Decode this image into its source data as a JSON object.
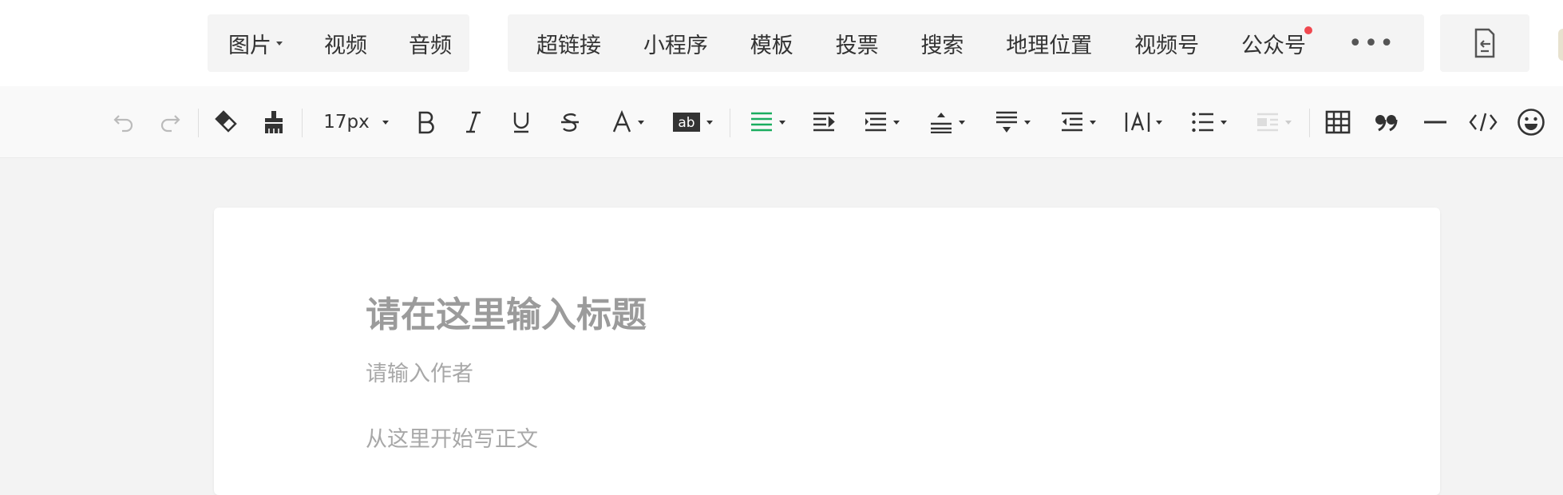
{
  "insert_bar": {
    "group1": [
      {
        "label": "图片",
        "dropdown": true
      },
      {
        "label": "视频"
      },
      {
        "label": "音频"
      }
    ],
    "group2": [
      {
        "label": "超链接"
      },
      {
        "label": "小程序"
      },
      {
        "label": "模板"
      },
      {
        "label": "投票"
      },
      {
        "label": "搜索"
      },
      {
        "label": "地理位置"
      },
      {
        "label": "视频号"
      },
      {
        "label": "公众号",
        "badge_dot": true
      }
    ],
    "more_icon": "more-dots-icon",
    "right_icon": "import-document-icon",
    "badge_color": "#f0484f"
  },
  "toolbar": {
    "font_size": "17px",
    "accent_color": "#1aad5f",
    "items": [
      "undo-icon",
      "redo-icon",
      "eraser-icon",
      "format-painter-icon",
      "font-size-select",
      "bold-icon",
      "italic-icon",
      "underline-icon",
      "strikethrough-icon",
      "font-color-icon",
      "background-color-icon",
      "align-icon",
      "indent-icon",
      "paragraph-spacing-icon",
      "line-height-before-icon",
      "line-height-after-icon",
      "line-indent-icon",
      "letter-spacing-icon",
      "list-icon",
      "float-icon",
      "table-icon",
      "quote-icon",
      "divider-icon",
      "code-icon",
      "emoji-icon"
    ]
  },
  "editor": {
    "title_placeholder": "请在这里输入标题",
    "author_placeholder": "请输入作者",
    "body_placeholder": "从这里开始写正文"
  }
}
